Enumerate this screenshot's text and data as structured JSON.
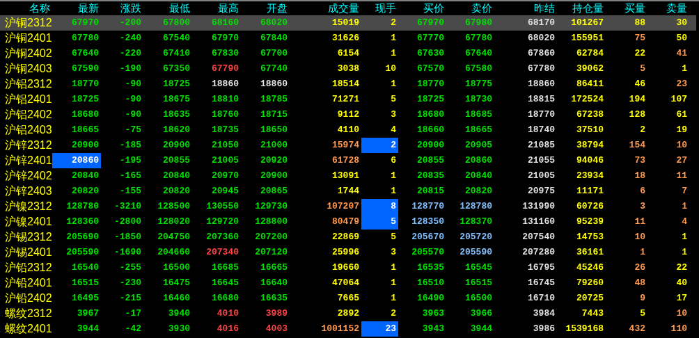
{
  "columns": [
    "名称",
    "最新",
    "涨跌",
    "最低",
    "最高",
    "开盘",
    "成交量",
    "现手",
    "买价",
    "卖价",
    "昨结",
    "持仓量",
    "买量",
    "卖量"
  ],
  "rows": [
    {
      "name": "沪铜2312",
      "selected": true,
      "cells": [
        {
          "text": "67970",
          "color": "#00e000",
          "flash": false
        },
        {
          "text": "-200",
          "color": "#00e000",
          "flash": false
        },
        {
          "text": "67800",
          "color": "#00e000",
          "flash": false
        },
        {
          "text": "68160",
          "color": "#00e000",
          "flash": false
        },
        {
          "text": "68020",
          "color": "#00e000",
          "flash": false
        },
        {
          "text": "15019",
          "color": "#ffff00",
          "flash": false
        },
        {
          "text": "2",
          "color": "#ffff00",
          "flash": false
        },
        {
          "text": "67970",
          "color": "#00e000",
          "flash": false
        },
        {
          "text": "67980",
          "color": "#00e000",
          "flash": false
        },
        {
          "text": "68170",
          "color": "#e0e0e0",
          "flash": false
        },
        {
          "text": "101267",
          "color": "#ffff00",
          "flash": false
        },
        {
          "text": "88",
          "color": "#ffff00",
          "flash": false
        },
        {
          "text": "30",
          "color": "#ffff00",
          "flash": false
        }
      ]
    },
    {
      "name": "沪铜2401",
      "selected": false,
      "cells": [
        {
          "text": "67780",
          "color": "#00e000",
          "flash": false
        },
        {
          "text": "-240",
          "color": "#00e000",
          "flash": false
        },
        {
          "text": "67540",
          "color": "#00e000",
          "flash": false
        },
        {
          "text": "67970",
          "color": "#00e000",
          "flash": false
        },
        {
          "text": "67840",
          "color": "#00e000",
          "flash": false
        },
        {
          "text": "31626",
          "color": "#ffff00",
          "flash": false
        },
        {
          "text": "1",
          "color": "#ffff00",
          "flash": false
        },
        {
          "text": "67770",
          "color": "#00e000",
          "flash": false
        },
        {
          "text": "67780",
          "color": "#00e000",
          "flash": false
        },
        {
          "text": "68020",
          "color": "#e0e0e0",
          "flash": false
        },
        {
          "text": "155951",
          "color": "#ffff00",
          "flash": false
        },
        {
          "text": "75",
          "color": "#ff9a50",
          "flash": false
        },
        {
          "text": "50",
          "color": "#ffff00",
          "flash": false
        }
      ]
    },
    {
      "name": "沪铜2402",
      "selected": false,
      "cells": [
        {
          "text": "67640",
          "color": "#00e000",
          "flash": false
        },
        {
          "text": "-220",
          "color": "#00e000",
          "flash": false
        },
        {
          "text": "67410",
          "color": "#00e000",
          "flash": false
        },
        {
          "text": "67830",
          "color": "#00e000",
          "flash": false
        },
        {
          "text": "67700",
          "color": "#00e000",
          "flash": false
        },
        {
          "text": "6154",
          "color": "#ffff00",
          "flash": false
        },
        {
          "text": "1",
          "color": "#ffff00",
          "flash": false
        },
        {
          "text": "67630",
          "color": "#00e000",
          "flash": false
        },
        {
          "text": "67640",
          "color": "#00e000",
          "flash": false
        },
        {
          "text": "67860",
          "color": "#e0e0e0",
          "flash": false
        },
        {
          "text": "62784",
          "color": "#ffff00",
          "flash": false
        },
        {
          "text": "22",
          "color": "#ffff00",
          "flash": false
        },
        {
          "text": "41",
          "color": "#ff9a50",
          "flash": false
        }
      ]
    },
    {
      "name": "沪铜2403",
      "selected": false,
      "cells": [
        {
          "text": "67590",
          "color": "#00e000",
          "flash": false
        },
        {
          "text": "-190",
          "color": "#00e000",
          "flash": false
        },
        {
          "text": "67350",
          "color": "#00e000",
          "flash": false
        },
        {
          "text": "67790",
          "color": "#ff4040",
          "flash": false
        },
        {
          "text": "67740",
          "color": "#00e000",
          "flash": false
        },
        {
          "text": "3038",
          "color": "#ffff00",
          "flash": false
        },
        {
          "text": "10",
          "color": "#ffff00",
          "flash": false
        },
        {
          "text": "67570",
          "color": "#00e000",
          "flash": false
        },
        {
          "text": "67580",
          "color": "#00e000",
          "flash": false
        },
        {
          "text": "67780",
          "color": "#e0e0e0",
          "flash": false
        },
        {
          "text": "39062",
          "color": "#ffff00",
          "flash": false
        },
        {
          "text": "5",
          "color": "#ff9a50",
          "flash": false
        },
        {
          "text": "1",
          "color": "#ffff00",
          "flash": false
        }
      ]
    },
    {
      "name": "沪铝2312",
      "selected": false,
      "cells": [
        {
          "text": "18770",
          "color": "#00e000",
          "flash": false
        },
        {
          "text": "-90",
          "color": "#00e000",
          "flash": false
        },
        {
          "text": "18725",
          "color": "#00e000",
          "flash": false
        },
        {
          "text": "18860",
          "color": "#e0e0e0",
          "flash": false
        },
        {
          "text": "18860",
          "color": "#e0e0e0",
          "flash": false
        },
        {
          "text": "18514",
          "color": "#ffff00",
          "flash": false
        },
        {
          "text": "1",
          "color": "#ffff00",
          "flash": false
        },
        {
          "text": "18770",
          "color": "#00e000",
          "flash": false
        },
        {
          "text": "18775",
          "color": "#00e000",
          "flash": false
        },
        {
          "text": "18860",
          "color": "#e0e0e0",
          "flash": false
        },
        {
          "text": "86411",
          "color": "#ffff00",
          "flash": false
        },
        {
          "text": "46",
          "color": "#ffff00",
          "flash": false
        },
        {
          "text": "23",
          "color": "#ff9a50",
          "flash": false
        }
      ]
    },
    {
      "name": "沪铝2401",
      "selected": false,
      "cells": [
        {
          "text": "18725",
          "color": "#00e000",
          "flash": false
        },
        {
          "text": "-90",
          "color": "#00e000",
          "flash": false
        },
        {
          "text": "18675",
          "color": "#00e000",
          "flash": false
        },
        {
          "text": "18810",
          "color": "#00e000",
          "flash": false
        },
        {
          "text": "18785",
          "color": "#00e000",
          "flash": false
        },
        {
          "text": "71271",
          "color": "#ffff00",
          "flash": false
        },
        {
          "text": "5",
          "color": "#ffff00",
          "flash": false
        },
        {
          "text": "18725",
          "color": "#00e000",
          "flash": false
        },
        {
          "text": "18730",
          "color": "#00e000",
          "flash": false
        },
        {
          "text": "18815",
          "color": "#e0e0e0",
          "flash": false
        },
        {
          "text": "172524",
          "color": "#ffff00",
          "flash": false
        },
        {
          "text": "194",
          "color": "#ffff00",
          "flash": false
        },
        {
          "text": "107",
          "color": "#ffff00",
          "flash": false
        }
      ]
    },
    {
      "name": "沪铝2402",
      "selected": false,
      "cells": [
        {
          "text": "18680",
          "color": "#00e000",
          "flash": false
        },
        {
          "text": "-90",
          "color": "#00e000",
          "flash": false
        },
        {
          "text": "18635",
          "color": "#00e000",
          "flash": false
        },
        {
          "text": "18760",
          "color": "#00e000",
          "flash": false
        },
        {
          "text": "18715",
          "color": "#00e000",
          "flash": false
        },
        {
          "text": "9112",
          "color": "#ffff00",
          "flash": false
        },
        {
          "text": "3",
          "color": "#ffff00",
          "flash": false
        },
        {
          "text": "18680",
          "color": "#00e000",
          "flash": false
        },
        {
          "text": "18685",
          "color": "#00e000",
          "flash": false
        },
        {
          "text": "18770",
          "color": "#e0e0e0",
          "flash": false
        },
        {
          "text": "67238",
          "color": "#ffff00",
          "flash": false
        },
        {
          "text": "128",
          "color": "#ffff00",
          "flash": false
        },
        {
          "text": "61",
          "color": "#ffff00",
          "flash": false
        }
      ]
    },
    {
      "name": "沪铝2403",
      "selected": false,
      "cells": [
        {
          "text": "18665",
          "color": "#00e000",
          "flash": false
        },
        {
          "text": "-75",
          "color": "#00e000",
          "flash": false
        },
        {
          "text": "18620",
          "color": "#00e000",
          "flash": false
        },
        {
          "text": "18735",
          "color": "#00e000",
          "flash": false
        },
        {
          "text": "18650",
          "color": "#00e000",
          "flash": false
        },
        {
          "text": "4110",
          "color": "#ffff00",
          "flash": false
        },
        {
          "text": "4",
          "color": "#ffff00",
          "flash": false
        },
        {
          "text": "18660",
          "color": "#00e000",
          "flash": false
        },
        {
          "text": "18665",
          "color": "#00e000",
          "flash": false
        },
        {
          "text": "18740",
          "color": "#e0e0e0",
          "flash": false
        },
        {
          "text": "37510",
          "color": "#ffff00",
          "flash": false
        },
        {
          "text": "2",
          "color": "#ffff00",
          "flash": false
        },
        {
          "text": "19",
          "color": "#ffff00",
          "flash": false
        }
      ]
    },
    {
      "name": "沪锌2312",
      "selected": false,
      "cells": [
        {
          "text": "20900",
          "color": "#00e000",
          "flash": false
        },
        {
          "text": "-185",
          "color": "#00e000",
          "flash": false
        },
        {
          "text": "20900",
          "color": "#00e000",
          "flash": false
        },
        {
          "text": "21050",
          "color": "#00e000",
          "flash": false
        },
        {
          "text": "21000",
          "color": "#00e000",
          "flash": false
        },
        {
          "text": "15974",
          "color": "#ff9a50",
          "flash": false
        },
        {
          "text": "2",
          "color": "#ffffff",
          "flash": true
        },
        {
          "text": "20900",
          "color": "#00e000",
          "flash": false
        },
        {
          "text": "20905",
          "color": "#00e000",
          "flash": false
        },
        {
          "text": "21085",
          "color": "#e0e0e0",
          "flash": false
        },
        {
          "text": "38794",
          "color": "#ffff00",
          "flash": false
        },
        {
          "text": "154",
          "color": "#ff9a50",
          "flash": false
        },
        {
          "text": "10",
          "color": "#ff9a50",
          "flash": false
        }
      ]
    },
    {
      "name": "沪锌2401",
      "selected": false,
      "cells": [
        {
          "text": "20860",
          "color": "#ffffff",
          "flash": true
        },
        {
          "text": "-195",
          "color": "#00e000",
          "flash": false
        },
        {
          "text": "20855",
          "color": "#00e000",
          "flash": false
        },
        {
          "text": "21005",
          "color": "#00e000",
          "flash": false
        },
        {
          "text": "20920",
          "color": "#00e000",
          "flash": false
        },
        {
          "text": "61728",
          "color": "#ff9a50",
          "flash": false
        },
        {
          "text": "6",
          "color": "#ffff00",
          "flash": false
        },
        {
          "text": "20855",
          "color": "#00e000",
          "flash": false
        },
        {
          "text": "20860",
          "color": "#00e000",
          "flash": false
        },
        {
          "text": "21055",
          "color": "#e0e0e0",
          "flash": false
        },
        {
          "text": "94046",
          "color": "#ffff00",
          "flash": false
        },
        {
          "text": "73",
          "color": "#ff9a50",
          "flash": false
        },
        {
          "text": "27",
          "color": "#ff9a50",
          "flash": false
        }
      ]
    },
    {
      "name": "沪锌2402",
      "selected": false,
      "cells": [
        {
          "text": "20840",
          "color": "#00e000",
          "flash": false
        },
        {
          "text": "-165",
          "color": "#00e000",
          "flash": false
        },
        {
          "text": "20840",
          "color": "#00e000",
          "flash": false
        },
        {
          "text": "20970",
          "color": "#00e000",
          "flash": false
        },
        {
          "text": "20900",
          "color": "#00e000",
          "flash": false
        },
        {
          "text": "13091",
          "color": "#ffff00",
          "flash": false
        },
        {
          "text": "1",
          "color": "#ffff00",
          "flash": false
        },
        {
          "text": "20835",
          "color": "#00e000",
          "flash": false
        },
        {
          "text": "20840",
          "color": "#00e000",
          "flash": false
        },
        {
          "text": "21005",
          "color": "#e0e0e0",
          "flash": false
        },
        {
          "text": "23934",
          "color": "#ffff00",
          "flash": false
        },
        {
          "text": "18",
          "color": "#ff9a50",
          "flash": false
        },
        {
          "text": "11",
          "color": "#ff9a50",
          "flash": false
        }
      ]
    },
    {
      "name": "沪锌2403",
      "selected": false,
      "cells": [
        {
          "text": "20820",
          "color": "#00e000",
          "flash": false
        },
        {
          "text": "-155",
          "color": "#00e000",
          "flash": false
        },
        {
          "text": "20820",
          "color": "#00e000",
          "flash": false
        },
        {
          "text": "20945",
          "color": "#00e000",
          "flash": false
        },
        {
          "text": "20865",
          "color": "#00e000",
          "flash": false
        },
        {
          "text": "1744",
          "color": "#ffff00",
          "flash": false
        },
        {
          "text": "1",
          "color": "#ffff00",
          "flash": false
        },
        {
          "text": "20815",
          "color": "#00e000",
          "flash": false
        },
        {
          "text": "20820",
          "color": "#00e000",
          "flash": false
        },
        {
          "text": "20975",
          "color": "#e0e0e0",
          "flash": false
        },
        {
          "text": "11171",
          "color": "#ffff00",
          "flash": false
        },
        {
          "text": "6",
          "color": "#ff9a50",
          "flash": false
        },
        {
          "text": "7",
          "color": "#ff9a50",
          "flash": false
        }
      ]
    },
    {
      "name": "沪镍2312",
      "selected": false,
      "cells": [
        {
          "text": "128780",
          "color": "#00e000",
          "flash": false
        },
        {
          "text": "-3210",
          "color": "#00e000",
          "flash": false
        },
        {
          "text": "128500",
          "color": "#00e000",
          "flash": false
        },
        {
          "text": "130550",
          "color": "#00e000",
          "flash": false
        },
        {
          "text": "129730",
          "color": "#00e000",
          "flash": false
        },
        {
          "text": "107207",
          "color": "#ff9a50",
          "flash": false
        },
        {
          "text": "8",
          "color": "#ffffff",
          "flash": true
        },
        {
          "text": "128770",
          "color": "#80c0ff",
          "flash": false
        },
        {
          "text": "128780",
          "color": "#80c0ff",
          "flash": false
        },
        {
          "text": "131990",
          "color": "#e0e0e0",
          "flash": false
        },
        {
          "text": "60726",
          "color": "#ffff00",
          "flash": false
        },
        {
          "text": "3",
          "color": "#ff9a50",
          "flash": false
        },
        {
          "text": "1",
          "color": "#ff9a50",
          "flash": false
        }
      ]
    },
    {
      "name": "沪镍2401",
      "selected": false,
      "cells": [
        {
          "text": "128360",
          "color": "#00e000",
          "flash": false
        },
        {
          "text": "-2800",
          "color": "#00e000",
          "flash": false
        },
        {
          "text": "128020",
          "color": "#00e000",
          "flash": false
        },
        {
          "text": "129720",
          "color": "#00e000",
          "flash": false
        },
        {
          "text": "128800",
          "color": "#00e000",
          "flash": false
        },
        {
          "text": "80479",
          "color": "#ff9a50",
          "flash": false
        },
        {
          "text": "5",
          "color": "#ffffff",
          "flash": true
        },
        {
          "text": "128350",
          "color": "#80c0ff",
          "flash": false
        },
        {
          "text": "128370",
          "color": "#00e000",
          "flash": false
        },
        {
          "text": "131160",
          "color": "#e0e0e0",
          "flash": false
        },
        {
          "text": "95239",
          "color": "#ffff00",
          "flash": false
        },
        {
          "text": "11",
          "color": "#ff9a50",
          "flash": false
        },
        {
          "text": "4",
          "color": "#ff9a50",
          "flash": false
        }
      ]
    },
    {
      "name": "沪锡2312",
      "selected": false,
      "cells": [
        {
          "text": "205690",
          "color": "#00e000",
          "flash": false
        },
        {
          "text": "-1850",
          "color": "#00e000",
          "flash": false
        },
        {
          "text": "204750",
          "color": "#00e000",
          "flash": false
        },
        {
          "text": "207360",
          "color": "#00e000",
          "flash": false
        },
        {
          "text": "207200",
          "color": "#00e000",
          "flash": false
        },
        {
          "text": "22869",
          "color": "#ffff00",
          "flash": false
        },
        {
          "text": "5",
          "color": "#ffff00",
          "flash": false
        },
        {
          "text": "205670",
          "color": "#80c0ff",
          "flash": false
        },
        {
          "text": "205720",
          "color": "#80c0ff",
          "flash": false
        },
        {
          "text": "207540",
          "color": "#e0e0e0",
          "flash": false
        },
        {
          "text": "14753",
          "color": "#ffff00",
          "flash": false
        },
        {
          "text": "10",
          "color": "#ff9a50",
          "flash": false
        },
        {
          "text": "1",
          "color": "#ffff00",
          "flash": false
        }
      ]
    },
    {
      "name": "沪锡2401",
      "selected": false,
      "cells": [
        {
          "text": "205590",
          "color": "#00e000",
          "flash": false
        },
        {
          "text": "-1690",
          "color": "#00e000",
          "flash": false
        },
        {
          "text": "204660",
          "color": "#00e000",
          "flash": false
        },
        {
          "text": "207340",
          "color": "#ff4040",
          "flash": false
        },
        {
          "text": "207120",
          "color": "#00e000",
          "flash": false
        },
        {
          "text": "25996",
          "color": "#ffff00",
          "flash": false
        },
        {
          "text": "3",
          "color": "#ffff00",
          "flash": false
        },
        {
          "text": "205570",
          "color": "#00e000",
          "flash": false
        },
        {
          "text": "205590",
          "color": "#80c0ff",
          "flash": false
        },
        {
          "text": "207280",
          "color": "#e0e0e0",
          "flash": false
        },
        {
          "text": "36161",
          "color": "#ffff00",
          "flash": false
        },
        {
          "text": "1",
          "color": "#ff9a50",
          "flash": false
        },
        {
          "text": "1",
          "color": "#ffff00",
          "flash": false
        }
      ]
    },
    {
      "name": "沪铅2312",
      "selected": false,
      "cells": [
        {
          "text": "16540",
          "color": "#00e000",
          "flash": false
        },
        {
          "text": "-255",
          "color": "#00e000",
          "flash": false
        },
        {
          "text": "16500",
          "color": "#00e000",
          "flash": false
        },
        {
          "text": "16685",
          "color": "#00e000",
          "flash": false
        },
        {
          "text": "16665",
          "color": "#00e000",
          "flash": false
        },
        {
          "text": "19660",
          "color": "#ffff00",
          "flash": false
        },
        {
          "text": "1",
          "color": "#ffff00",
          "flash": false
        },
        {
          "text": "16535",
          "color": "#00e000",
          "flash": false
        },
        {
          "text": "16545",
          "color": "#00e000",
          "flash": false
        },
        {
          "text": "16795",
          "color": "#e0e0e0",
          "flash": false
        },
        {
          "text": "45246",
          "color": "#ffff00",
          "flash": false
        },
        {
          "text": "26",
          "color": "#ff9a50",
          "flash": false
        },
        {
          "text": "22",
          "color": "#ffff00",
          "flash": false
        }
      ]
    },
    {
      "name": "沪铅2401",
      "selected": false,
      "cells": [
        {
          "text": "16515",
          "color": "#00e000",
          "flash": false
        },
        {
          "text": "-230",
          "color": "#00e000",
          "flash": false
        },
        {
          "text": "16475",
          "color": "#00e000",
          "flash": false
        },
        {
          "text": "16645",
          "color": "#00e000",
          "flash": false
        },
        {
          "text": "16640",
          "color": "#00e000",
          "flash": false
        },
        {
          "text": "47064",
          "color": "#ffff00",
          "flash": false
        },
        {
          "text": "1",
          "color": "#ffff00",
          "flash": false
        },
        {
          "text": "16510",
          "color": "#00e000",
          "flash": false
        },
        {
          "text": "16515",
          "color": "#00e000",
          "flash": false
        },
        {
          "text": "16745",
          "color": "#e0e0e0",
          "flash": false
        },
        {
          "text": "79260",
          "color": "#ffff00",
          "flash": false
        },
        {
          "text": "48",
          "color": "#ff9a50",
          "flash": false
        },
        {
          "text": "40",
          "color": "#ffff00",
          "flash": false
        }
      ]
    },
    {
      "name": "沪铅2402",
      "selected": false,
      "cells": [
        {
          "text": "16495",
          "color": "#00e000",
          "flash": false
        },
        {
          "text": "-215",
          "color": "#00e000",
          "flash": false
        },
        {
          "text": "16460",
          "color": "#00e000",
          "flash": false
        },
        {
          "text": "16680",
          "color": "#00e000",
          "flash": false
        },
        {
          "text": "16635",
          "color": "#00e000",
          "flash": false
        },
        {
          "text": "7665",
          "color": "#ffff00",
          "flash": false
        },
        {
          "text": "1",
          "color": "#ffff00",
          "flash": false
        },
        {
          "text": "16490",
          "color": "#00e000",
          "flash": false
        },
        {
          "text": "16500",
          "color": "#00e000",
          "flash": false
        },
        {
          "text": "16710",
          "color": "#e0e0e0",
          "flash": false
        },
        {
          "text": "20725",
          "color": "#ffff00",
          "flash": false
        },
        {
          "text": "9",
          "color": "#ff9a50",
          "flash": false
        },
        {
          "text": "17",
          "color": "#ffff00",
          "flash": false
        }
      ]
    },
    {
      "name": "螺纹2312",
      "selected": false,
      "cells": [
        {
          "text": "3967",
          "color": "#00e000",
          "flash": false
        },
        {
          "text": "-17",
          "color": "#00e000",
          "flash": false
        },
        {
          "text": "3940",
          "color": "#00e000",
          "flash": false
        },
        {
          "text": "4010",
          "color": "#ff4040",
          "flash": false
        },
        {
          "text": "3989",
          "color": "#ff4040",
          "flash": false
        },
        {
          "text": "2892",
          "color": "#ffff00",
          "flash": false
        },
        {
          "text": "2",
          "color": "#ffff00",
          "flash": false
        },
        {
          "text": "3963",
          "color": "#00e000",
          "flash": false
        },
        {
          "text": "3966",
          "color": "#00e000",
          "flash": false
        },
        {
          "text": "3984",
          "color": "#e0e0e0",
          "flash": false
        },
        {
          "text": "7443",
          "color": "#ffff00",
          "flash": false
        },
        {
          "text": "5",
          "color": "#ffff00",
          "flash": false
        },
        {
          "text": "10",
          "color": "#ff9a50",
          "flash": false
        }
      ]
    },
    {
      "name": "螺纹2401",
      "selected": false,
      "cells": [
        {
          "text": "3944",
          "color": "#00e000",
          "flash": false
        },
        {
          "text": "-42",
          "color": "#00e000",
          "flash": false
        },
        {
          "text": "3930",
          "color": "#00e000",
          "flash": false
        },
        {
          "text": "4016",
          "color": "#ff4040",
          "flash": false
        },
        {
          "text": "4003",
          "color": "#ff4040",
          "flash": false
        },
        {
          "text": "1001152",
          "color": "#ff9a50",
          "flash": false
        },
        {
          "text": "23",
          "color": "#ffffff",
          "flash": true
        },
        {
          "text": "3943",
          "color": "#00e000",
          "flash": false
        },
        {
          "text": "3944",
          "color": "#00e000",
          "flash": false
        },
        {
          "text": "3986",
          "color": "#e0e0e0",
          "flash": false
        },
        {
          "text": "1539168",
          "color": "#ffff00",
          "flash": false
        },
        {
          "text": "432",
          "color": "#ff9a50",
          "flash": false
        },
        {
          "text": "110",
          "color": "#ff9a50",
          "flash": false
        }
      ]
    }
  ]
}
